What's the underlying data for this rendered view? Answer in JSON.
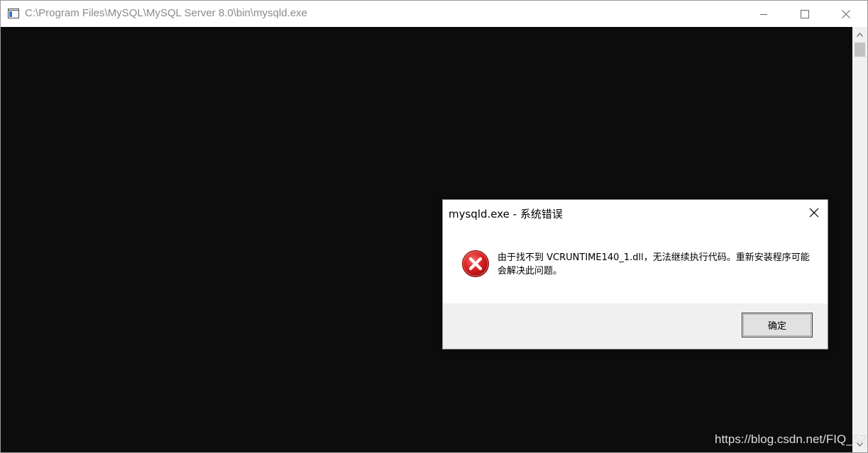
{
  "window": {
    "title": "C:\\Program Files\\MySQL\\MySQL Server 8.0\\bin\\mysqld.exe",
    "app_icon": "console-app-icon",
    "controls": [
      "minimize-icon",
      "maximize-icon",
      "close-icon"
    ]
  },
  "console": {
    "background": "#0c0c0c"
  },
  "dialog": {
    "title": "mysqld.exe - 系统错误",
    "icon": "error-icon",
    "message": "由于找不到 VCRUNTIME140_1.dll，无法继续执行代码。重新安装程序可能会解决此问题。",
    "ok_label": "确定",
    "error_color": "#d81e1e"
  },
  "watermark": {
    "text": "https://blog.csdn.net/FIQ_52"
  }
}
